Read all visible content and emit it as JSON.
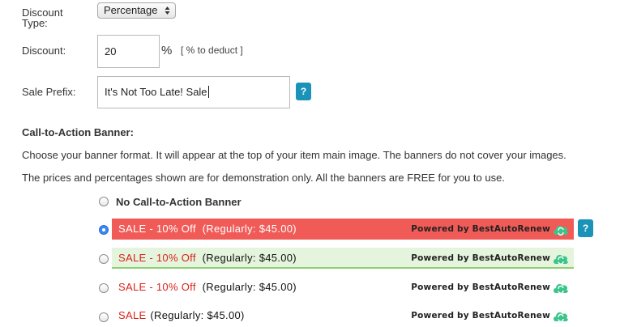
{
  "form": {
    "discount_type_label": "Discount Type:",
    "discount_type_value": "Percentage",
    "discount_label": "Discount:",
    "discount_value": "20",
    "percent_symbol": "%",
    "discount_hint": "[ % to deduct ]",
    "sale_prefix_label": "Sale Prefix:",
    "sale_prefix_value": "It's Not Too Late! Sale",
    "help_glyph": "?"
  },
  "cta": {
    "heading": "Call-to-Action Banner:",
    "description1": "Choose your banner format. It will appear at the top of your item main image. The banners do not cover your images.",
    "description2": "The prices and percentages shown are for demonstration only. All the banners are FREE for you to use.",
    "options": [
      {
        "label": "No Call-to-Action Banner",
        "selected": false
      },
      {
        "sale": "SALE - 10% Off",
        "regular": "(Regularly: $45.00)",
        "powered": "Powered by BestAutoRenew",
        "style": "red-fill",
        "selected": true
      },
      {
        "sale": "SALE - 10% Off",
        "regular": "(Regularly: $45.00)",
        "powered": "Powered by BestAutoRenew",
        "style": "green-light",
        "selected": false
      },
      {
        "sale": "SALE - 10% Off",
        "regular": "(Regularly: $45.00)",
        "powered": "Powered by BestAutoRenew",
        "style": "plain",
        "selected": false
      },
      {
        "sale": "SALE",
        "regular": "(Regularly: $45.00)",
        "powered": "Powered by BestAutoRenew",
        "style": "plain",
        "selected": false
      }
    ]
  },
  "colors": {
    "help_button": "#1b93b8",
    "banner_red": "#f05b57",
    "banner_green_bg": "#e5f4dc",
    "sale_red_text": "#d8231b",
    "logo_green": "#3cc58a"
  },
  "icons": {
    "select_arrows": "updown-arrows-icon",
    "help": "question-icon",
    "logo": "bestautorenew-logo-icon"
  }
}
